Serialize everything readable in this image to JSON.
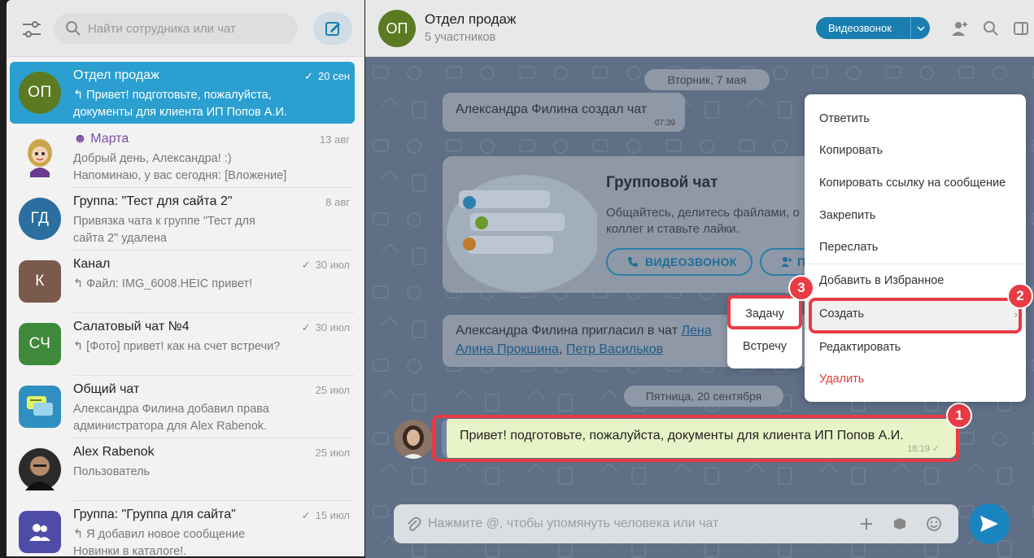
{
  "colors": {
    "accent": "#2a9fd0",
    "button_blue": "#1a7fb0",
    "highlight_red": "#e83b45",
    "danger": "#e53935"
  },
  "sidebar": {
    "search_placeholder": "Найти сотрудника или чат",
    "filter_icon": "sliders-icon",
    "compose_icon": "edit-icon",
    "chats": [
      {
        "initials": "ОП",
        "title": "Отдел продаж",
        "date": "20 сен",
        "read": true,
        "line1": "↰ Привет! подготовьте, пожалуйста,",
        "line2": "документы для клиента ИП Попов А.И.",
        "color": "#5b7a22",
        "active": true
      },
      {
        "initials": "",
        "title": "Марта",
        "date": "13 авг",
        "read": false,
        "line1": "Добрый день, Александра! :)",
        "line2": "Напоминаю, у вас сегодня: [Вложение]",
        "color": "#c9a64a",
        "active": false,
        "bot": true
      },
      {
        "initials": "ГД",
        "title": "Группа: \"Тест для сайта 2\"",
        "date": "8 авг",
        "read": false,
        "line1": "Привязка чата к группе \"Тест для",
        "line2": "сайта 2\" удалена",
        "color": "#2a6fa0",
        "active": false
      },
      {
        "initials": "К",
        "title": "Канал",
        "date": "30 июл",
        "read": true,
        "line1": "↰ Файл: IMG_6008.HEIC привет!",
        "line2": "",
        "color": "#7a5a4a",
        "active": false
      },
      {
        "initials": "СЧ",
        "title": "Салатовый чат №4",
        "date": "30 июл",
        "read": true,
        "line1": "↰ [Фото] привет! как на счет встречи?",
        "line2": "",
        "color": "#3f8a3a",
        "active": false
      },
      {
        "initials": "",
        "title": "Общий чат",
        "date": "25 июл",
        "read": false,
        "line1": "Александра Филина добавил права",
        "line2": "администратора для Alex Rabenok.",
        "color": "#2f8fc0",
        "active": false,
        "icon": "chat-bubbles-icon"
      },
      {
        "initials": "",
        "title": "Alex Rabenok",
        "date": "25 июл",
        "read": false,
        "line1": "Пользователь",
        "line2": "",
        "color": "#2b2b2b",
        "active": false
      },
      {
        "initials": "",
        "title": "Группа: \"Группа для сайта\"",
        "date": "15 июл",
        "read": true,
        "line1": "↰ Я добавил новое сообщение",
        "line2": "Новинки в каталоге!.",
        "color": "#4f4ca8",
        "active": false,
        "icon": "group-icon"
      }
    ]
  },
  "header": {
    "avatar_initials": "ОП",
    "title": "Отдел продаж",
    "subtitle": "5 участников",
    "video_label": "Видеозвонок",
    "icons": [
      "add-user-icon",
      "search-icon",
      "panel-icon"
    ]
  },
  "chat": {
    "date1": "Вторник, 7 мая",
    "system_msg": "Александра Филина создал чат",
    "system_time": "07:39",
    "card_title": "Групповой чат",
    "card_text1": "Общайтесь, делитесь файлами, о",
    "card_text2": "коллег и ставьте лайки.",
    "card_btn_video": "ВИДЕОЗВОНОК",
    "card_btn_add": "П",
    "invite_prefix": "Александра Филина пригласил в чат ",
    "invite_link1": "Лена",
    "invite_link2": "Алина Прокшина",
    "invite_sep": ", ",
    "invite_link3": "Петр Васильков",
    "date2": "Пятница, 20 сентября",
    "message_text": "Привет! подготовьте, пожалуйста, документы для клиента ИП Попов А.И.",
    "message_time": "18:19"
  },
  "composer": {
    "placeholder": "Нажмите @, чтобы упомянуть человека или чат",
    "icons": [
      "attach-icon",
      "plus-icon",
      "box-icon",
      "smile-icon",
      "send-icon"
    ]
  },
  "context_menu": {
    "items": [
      "Ответить",
      "Копировать",
      "Копировать ссылку на сообщение",
      "Закрепить",
      "Переслать",
      "Добавить в Избранное",
      "Создать",
      "Редактировать",
      "Удалить"
    ],
    "create_chevron": "›"
  },
  "submenu": {
    "items": [
      "Задачу",
      "Встречу"
    ]
  },
  "badges": [
    "1",
    "2",
    "3"
  ]
}
